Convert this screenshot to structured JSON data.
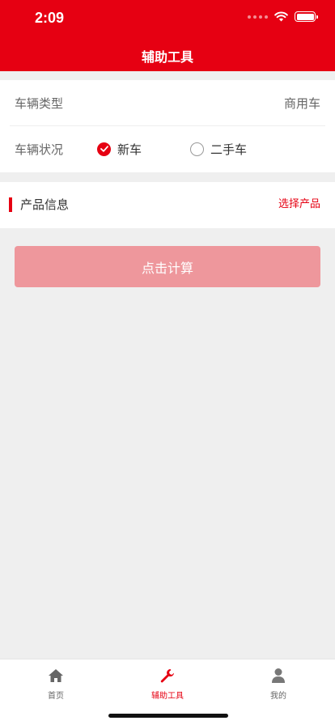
{
  "status_bar": {
    "time": "2:09"
  },
  "nav": {
    "title": "辅助工具"
  },
  "vehicle": {
    "type_label": "车辆类型",
    "type_value": "商用车",
    "condition_label": "车辆状况",
    "options": [
      {
        "label": "新车",
        "selected": true
      },
      {
        "label": "二手车",
        "selected": false
      }
    ]
  },
  "product": {
    "title": "产品信息",
    "select_link": "选择产品"
  },
  "calculate_button": "点击计算",
  "tabbar": {
    "items": [
      {
        "label": "首页",
        "icon": "home-icon",
        "active": false
      },
      {
        "label": "辅助工具",
        "icon": "wrench-icon",
        "active": true
      },
      {
        "label": "我的",
        "icon": "user-icon",
        "active": false
      }
    ]
  },
  "colors": {
    "brand": "#e60012",
    "button_disabled": "#ee979c",
    "background": "#efefef"
  }
}
